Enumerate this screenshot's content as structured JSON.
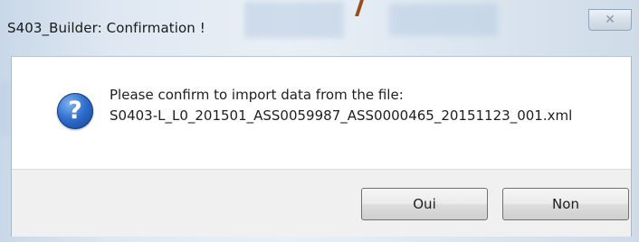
{
  "window": {
    "title": "S403_Builder: Confirmation !",
    "close_glyph": "✕"
  },
  "message": {
    "line1": "Please confirm to import data from the file:",
    "line2": "S0403-L_L0_201501_ASS0059987_ASS0000465_20151123_001.xml",
    "icon": "question-icon",
    "icon_glyph": "?"
  },
  "buttons": {
    "yes_label": "Oui",
    "no_label": "Non"
  },
  "colors": {
    "icon_blue": "#2f6fcf",
    "button_bar": "#f0f0f0"
  }
}
